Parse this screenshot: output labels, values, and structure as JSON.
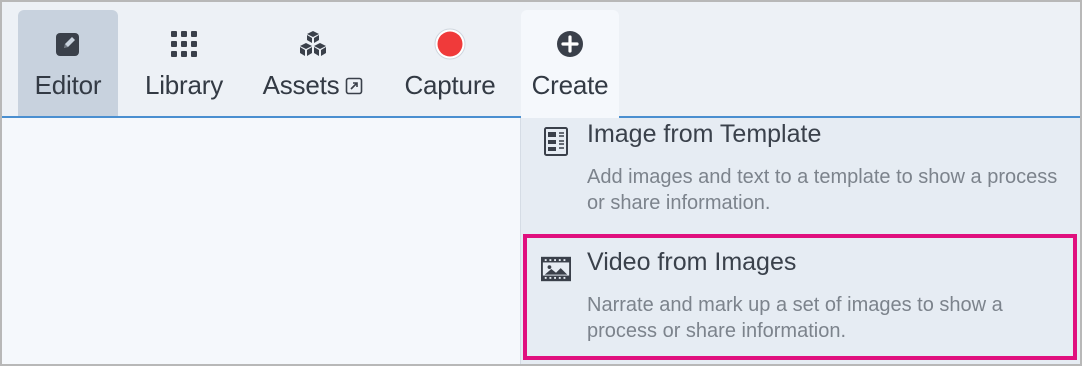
{
  "toolbar": {
    "items": [
      {
        "label": "Editor",
        "icon": "pencil-square-icon",
        "active": true
      },
      {
        "label": "Library",
        "icon": "grid-icon",
        "active": false
      },
      {
        "label": "Assets",
        "icon": "cubes-icon",
        "external_icon": "external-link-icon",
        "active": false
      },
      {
        "label": "Capture",
        "icon": "record-icon",
        "active": false
      },
      {
        "label": "Create",
        "icon": "plus-circle-icon",
        "active": false,
        "open": true
      }
    ]
  },
  "create_menu": {
    "items": [
      {
        "title": "Image from Template",
        "description": "Add images and text to a template to show a process or share information.",
        "icon": "template-icon"
      },
      {
        "title": "Video from Images",
        "description": "Narrate and mark up a set of images to show a process or share information.",
        "icon": "filmstrip-image-icon",
        "highlighted": true
      }
    ]
  },
  "colors": {
    "accent_line": "#4a8fd0",
    "highlight_border": "#e0107e",
    "record_red": "#f03a3a",
    "icon_dark": "#3a404a"
  }
}
